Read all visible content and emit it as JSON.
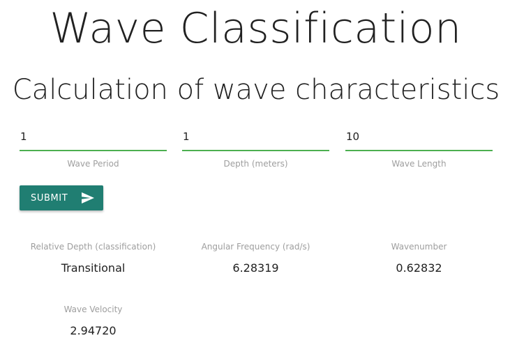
{
  "header": {
    "title": "Wave Classification",
    "subtitle": "Calculation of wave characteristics"
  },
  "form": {
    "fields": [
      {
        "value": "1",
        "label": "Wave Period"
      },
      {
        "value": "1",
        "label": "Depth (meters)"
      },
      {
        "value": "10",
        "label": "Wave Length"
      }
    ],
    "submit_label": "SUBMIT",
    "submit_icon": "send-icon"
  },
  "results": [
    {
      "label": "Relative Depth (classification)",
      "value": "Transitional"
    },
    {
      "label": "Angular Frequency (rad/s)",
      "value": "6.28319"
    },
    {
      "label": "Wavenumber",
      "value": "0.62832"
    },
    {
      "label": "Wave Velocity",
      "value": "2.94720"
    }
  ],
  "colors": {
    "accent": "#207e72",
    "input_underline": "#4caf50",
    "label_text": "#9e9e9e"
  }
}
